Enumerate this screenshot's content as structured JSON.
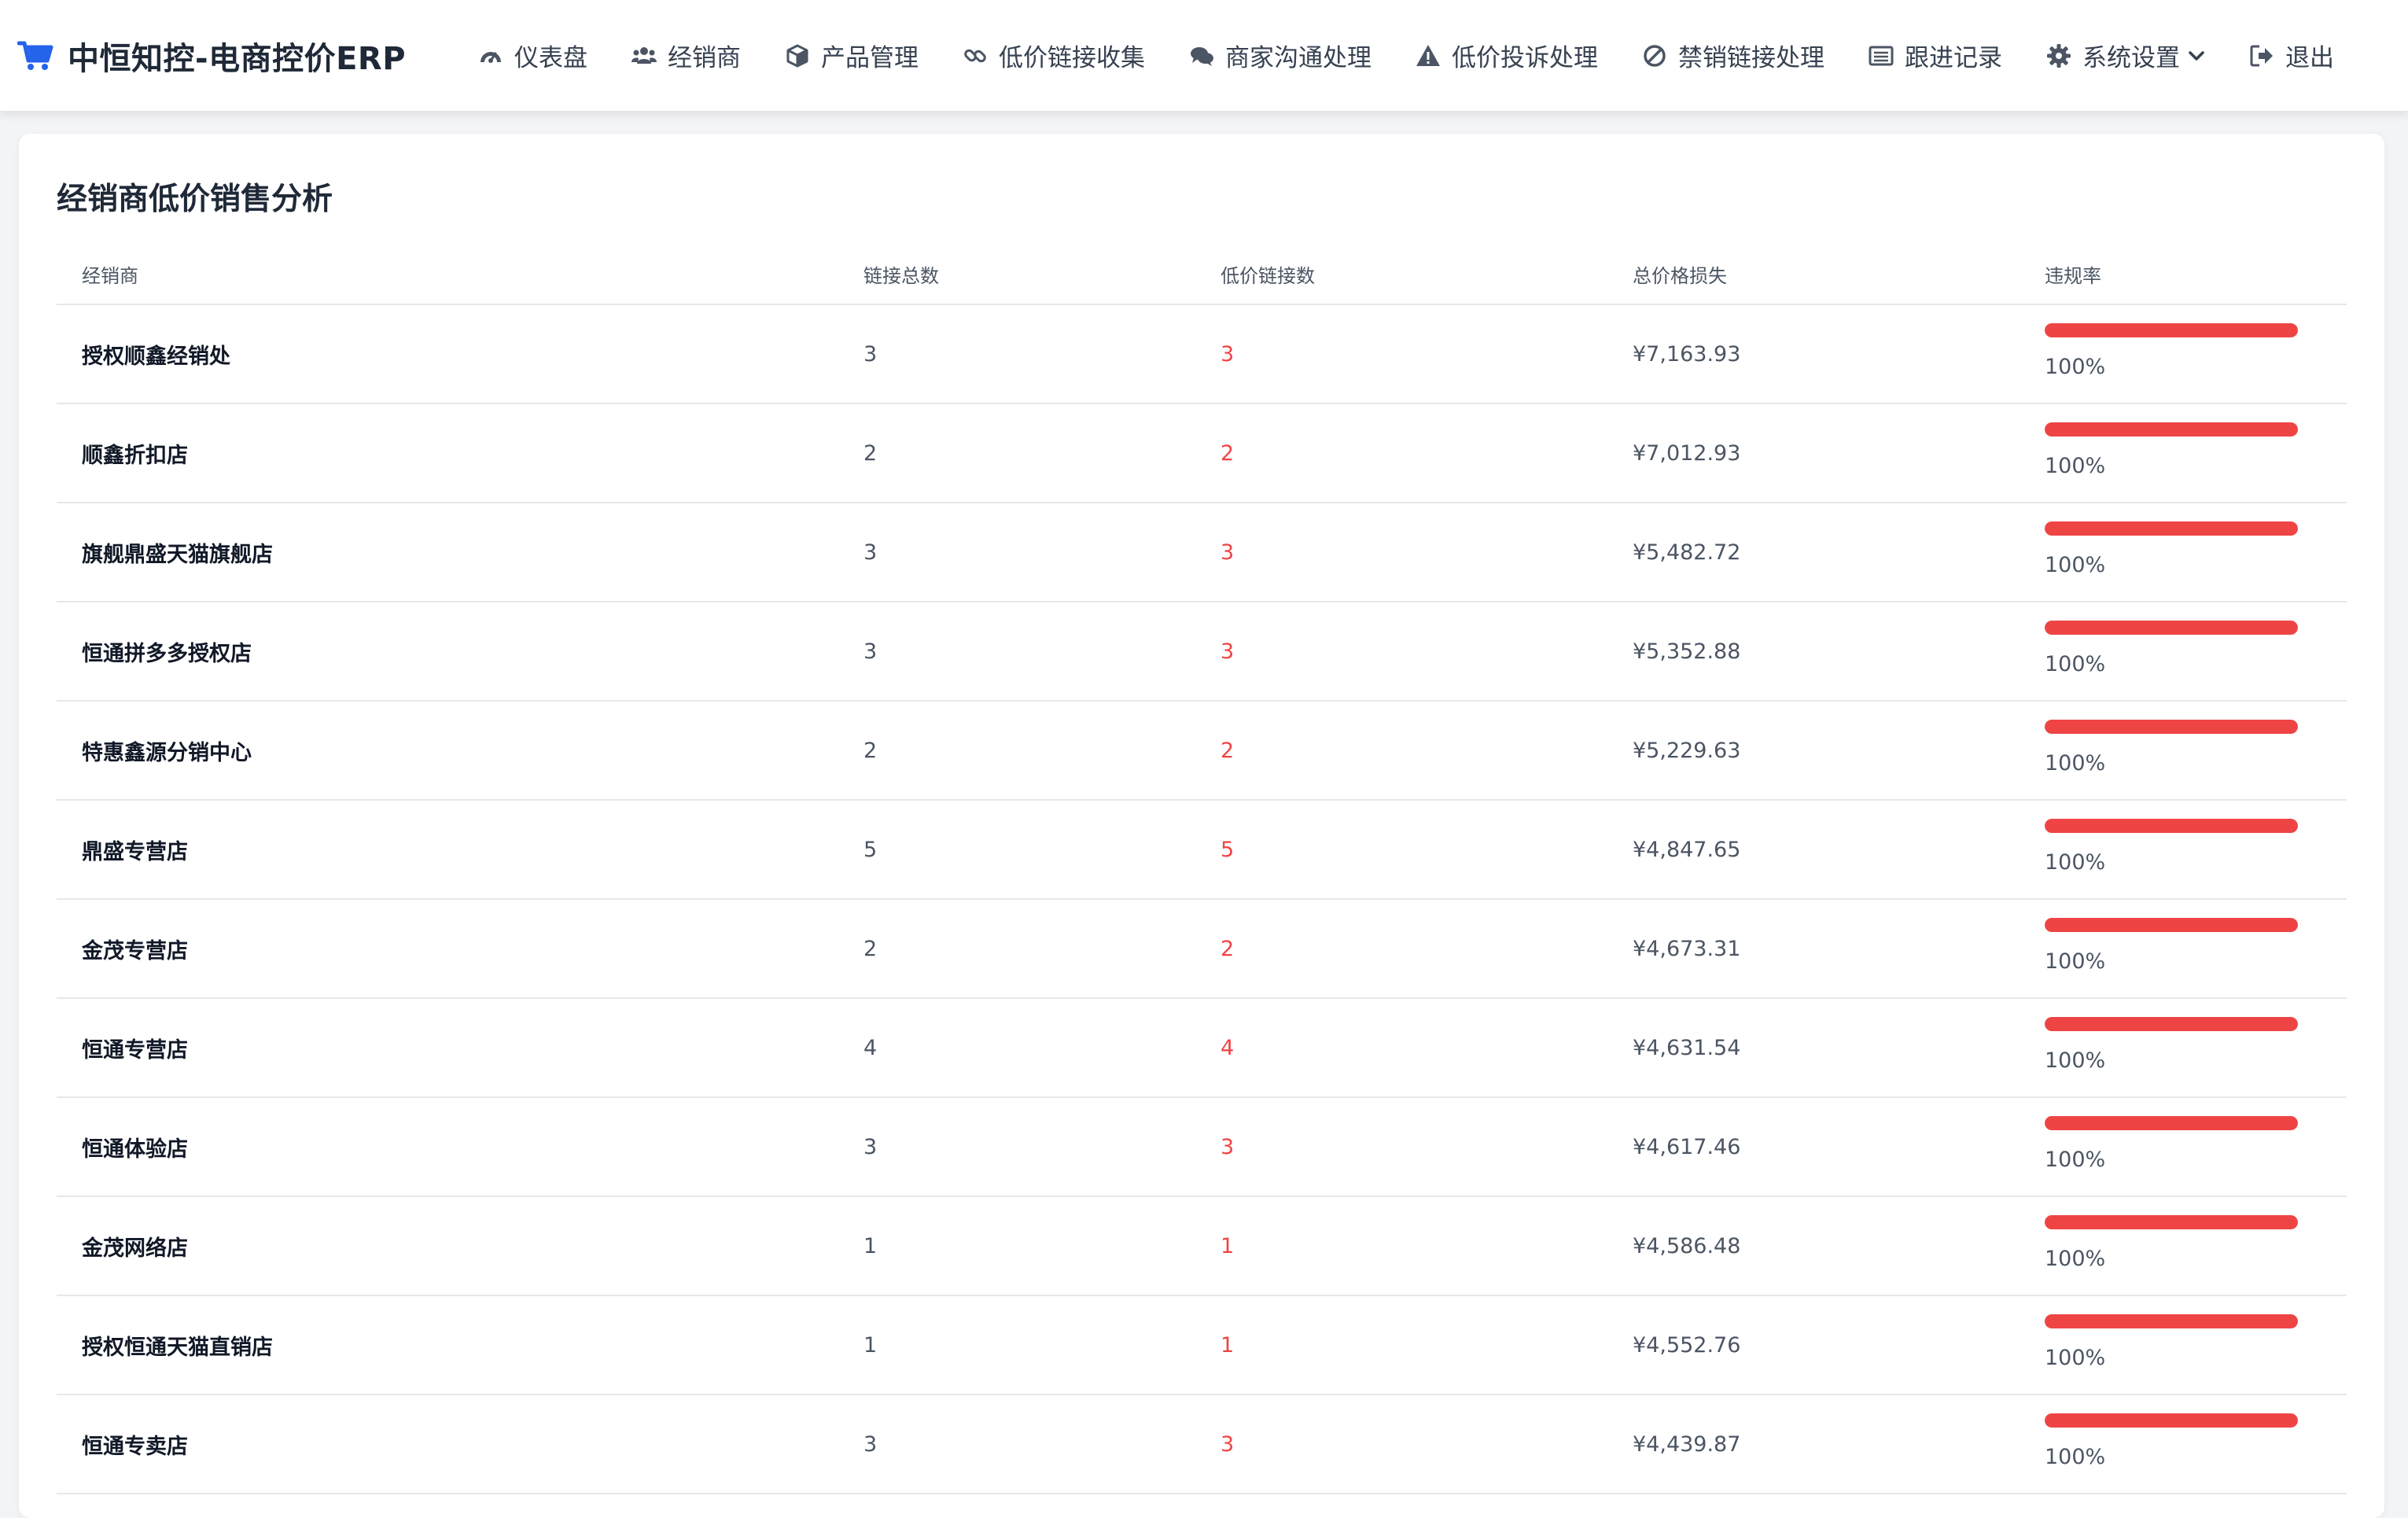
{
  "app": {
    "title": "中恒知控-电商控价ERP",
    "brand_icon": "cart-icon",
    "accent_color": "#2563eb"
  },
  "nav": {
    "items": [
      {
        "label": "仪表盘",
        "icon": "dashboard-icon"
      },
      {
        "label": "经销商",
        "icon": "users-icon"
      },
      {
        "label": "产品管理",
        "icon": "cube-icon"
      },
      {
        "label": "低价链接收集",
        "icon": "link-icon"
      },
      {
        "label": "商家沟通处理",
        "icon": "comments-icon"
      },
      {
        "label": "低价投诉处理",
        "icon": "warning-icon"
      },
      {
        "label": "禁销链接处理",
        "icon": "ban-icon"
      },
      {
        "label": "跟进记录",
        "icon": "list-icon"
      },
      {
        "label": "系统设置",
        "icon": "gear-icon",
        "dropdown": true
      },
      {
        "label": "退出",
        "icon": "logout-icon"
      }
    ]
  },
  "card": {
    "title": "经销商低价销售分析"
  },
  "table": {
    "headers": {
      "name": "经销商",
      "total": "链接总数",
      "low": "低价链接数",
      "loss": "总价格损失",
      "rate": "违规率"
    },
    "rows": [
      {
        "name": "授权顺鑫经销处",
        "total": "3",
        "low": "3",
        "loss": "¥7,163.93",
        "rate_text": "100%",
        "rate": 1.0
      },
      {
        "name": "顺鑫折扣店",
        "total": "2",
        "low": "2",
        "loss": "¥7,012.93",
        "rate_text": "100%",
        "rate": 1.0
      },
      {
        "name": "旗舰鼎盛天猫旗舰店",
        "total": "3",
        "low": "3",
        "loss": "¥5,482.72",
        "rate_text": "100%",
        "rate": 1.0
      },
      {
        "name": "恒通拼多多授权店",
        "total": "3",
        "low": "3",
        "loss": "¥5,352.88",
        "rate_text": "100%",
        "rate": 1.0
      },
      {
        "name": "特惠鑫源分销中心",
        "total": "2",
        "low": "2",
        "loss": "¥5,229.63",
        "rate_text": "100%",
        "rate": 1.0
      },
      {
        "name": "鼎盛专营店",
        "total": "5",
        "low": "5",
        "loss": "¥4,847.65",
        "rate_text": "100%",
        "rate": 1.0
      },
      {
        "name": "金茂专营店",
        "total": "2",
        "low": "2",
        "loss": "¥4,673.31",
        "rate_text": "100%",
        "rate": 1.0
      },
      {
        "name": "恒通专营店",
        "total": "4",
        "low": "4",
        "loss": "¥4,631.54",
        "rate_text": "100%",
        "rate": 1.0
      },
      {
        "name": "恒通体验店",
        "total": "3",
        "low": "3",
        "loss": "¥4,617.46",
        "rate_text": "100%",
        "rate": 1.0
      },
      {
        "name": "金茂网络店",
        "total": "1",
        "low": "1",
        "loss": "¥4,586.48",
        "rate_text": "100%",
        "rate": 1.0
      },
      {
        "name": "授权恒通天猫直销店",
        "total": "1",
        "low": "1",
        "loss": "¥4,552.76",
        "rate_text": "100%",
        "rate": 1.0
      },
      {
        "name": "恒通专卖店",
        "total": "3",
        "low": "3",
        "loss": "¥4,439.87",
        "rate_text": "100%",
        "rate": 1.0
      }
    ]
  },
  "colors": {
    "danger": "#ef4444",
    "text_muted": "#4b5563",
    "border": "#e5e7eb"
  }
}
